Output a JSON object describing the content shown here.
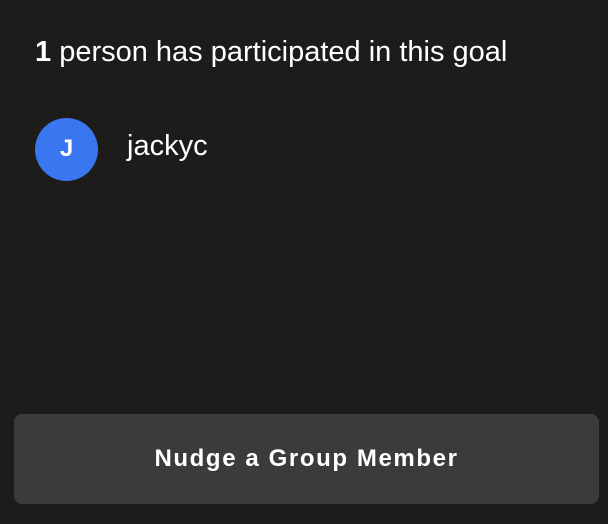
{
  "participation": {
    "count": "1",
    "text": " person has participated in this goal"
  },
  "participants": [
    {
      "initial": "J",
      "name": "jackyc",
      "avatar_color": "#3a76f0"
    }
  ],
  "actions": {
    "nudge_label": "Nudge a Group Member"
  },
  "colors": {
    "background": "#1d1c1b",
    "button_background": "#3c3b3a",
    "text": "#ffffff"
  }
}
